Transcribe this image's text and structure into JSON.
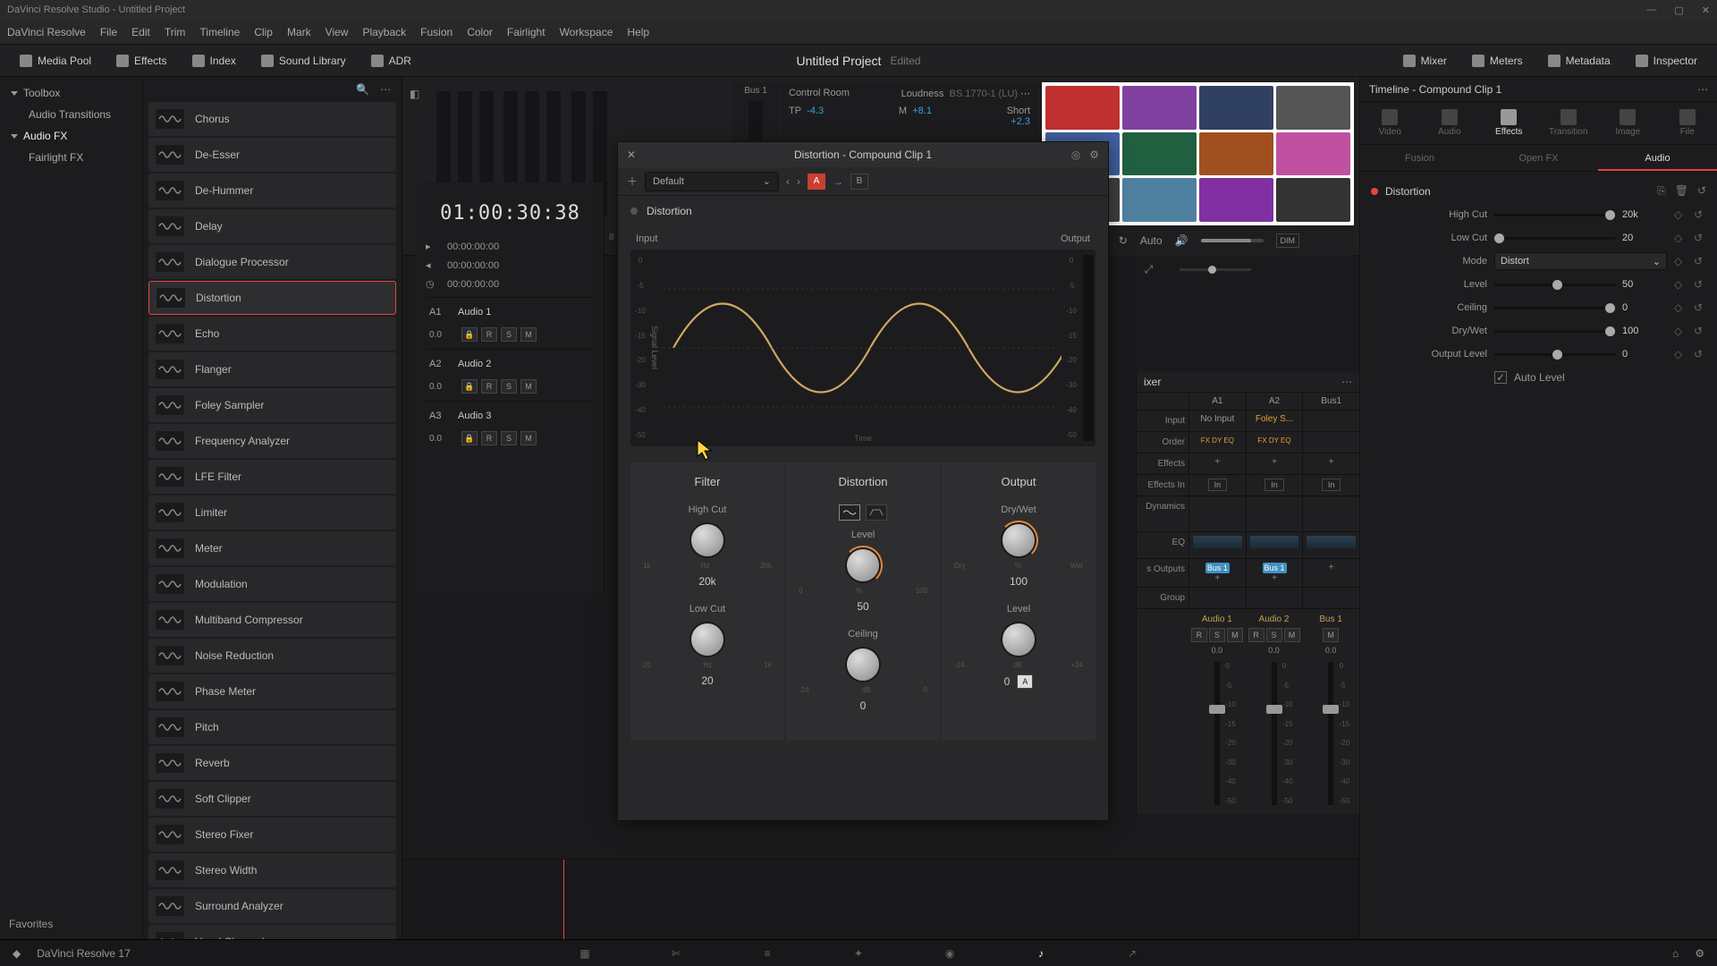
{
  "app": {
    "title": "DaVinci Resolve Studio - Untitled Project",
    "version": "DaVinci Resolve 17"
  },
  "menu": [
    "DaVinci Resolve",
    "File",
    "Edit",
    "Trim",
    "Timeline",
    "Clip",
    "Mark",
    "View",
    "Playback",
    "Fusion",
    "Color",
    "Fairlight",
    "Workspace",
    "Help"
  ],
  "toolbar": {
    "left": [
      {
        "label": "Media Pool"
      },
      {
        "label": "Effects"
      },
      {
        "label": "Index"
      },
      {
        "label": "Sound Library"
      },
      {
        "label": "ADR"
      }
    ],
    "right": [
      {
        "label": "Mixer"
      },
      {
        "label": "Meters"
      },
      {
        "label": "Metadata"
      },
      {
        "label": "Inspector"
      }
    ],
    "project": "Untitled Project",
    "edited": "Edited"
  },
  "tree": {
    "toolbox": "Toolbox",
    "audiotrans": "Audio Transitions",
    "audiofx": "Audio FX",
    "fairlight": "Fairlight FX",
    "favorites": "Favorites"
  },
  "fx": [
    "Chorus",
    "De-Esser",
    "De-Hummer",
    "Delay",
    "Dialogue Processor",
    "Distortion",
    "Echo",
    "Flanger",
    "Foley Sampler",
    "Frequency Analyzer",
    "LFE Filter",
    "Limiter",
    "Meter",
    "Modulation",
    "Multiband Compressor",
    "Noise Reduction",
    "Phase Meter",
    "Pitch",
    "Reverb",
    "Soft Clipper",
    "Stereo Fixer",
    "Stereo Width",
    "Surround Analyzer",
    "Vocal Channel"
  ],
  "fx_selected": "Distortion",
  "timecode": {
    "big": "01:00:30:38",
    "rows": [
      "00:00:00:00",
      "00:00:00:00",
      "00:00:00:00"
    ]
  },
  "tracks": [
    {
      "id": "A1",
      "name": "Audio 1",
      "vol": "0.0"
    },
    {
      "id": "A2",
      "name": "Audio 2",
      "vol": "0.0"
    },
    {
      "id": "A3",
      "name": "Audio 3",
      "vol": "0.0"
    }
  ],
  "control_room": {
    "title": "Control Room",
    "bus": "Bus 1",
    "loudness": "Loudness",
    "spec": "BS.1770-1 (LU)",
    "tp": "TP",
    "tpv": "-4.3",
    "m": "M",
    "mv": "+8.1",
    "short": "Short",
    "shortv": "+2.3"
  },
  "playback": {
    "auto": "Auto",
    "dim": "DIM"
  },
  "plugin": {
    "title": "Distortion - Compound Clip 1",
    "preset": "Default",
    "name": "Distortion",
    "input": "Input",
    "output": "Output",
    "time": "Time",
    "signal": "Signal Level",
    "sections": {
      "filter": "Filter",
      "distortion": "Distortion",
      "output": "Output"
    },
    "knobs": {
      "highcut": {
        "label": "High Cut",
        "scale_l": "1k",
        "scale_m": "Hz",
        "scale_r": "20k",
        "value": "20k"
      },
      "lowcut": {
        "label": "Low Cut",
        "scale_l": "20",
        "scale_m": "Hz",
        "scale_r": "1k",
        "value": "20"
      },
      "level": {
        "label": "Level",
        "scale_l": "0",
        "scale_m": "%",
        "scale_r": "100",
        "value": "50"
      },
      "ceiling": {
        "label": "Ceiling",
        "scale_l": "-24",
        "scale_m": "dB",
        "scale_r": "0",
        "value": "0"
      },
      "drywet": {
        "label": "Dry/Wet",
        "scale_l": "Dry",
        "scale_m": "%",
        "scale_r": "Wet",
        "value": "100"
      },
      "outlevel": {
        "label": "Level",
        "scale_l": "-24",
        "scale_m": "dB",
        "scale_r": "+24",
        "value": "0"
      }
    },
    "auto_btn": "A"
  },
  "mixer": {
    "title": "ixer",
    "cols": [
      "A1",
      "A2",
      "Bus1"
    ],
    "rows": {
      "input": "Input",
      "input_vals": [
        "No Input",
        "Foley S...",
        ""
      ],
      "order": "Order",
      "effects": "Effects",
      "effectsin": "Effects In",
      "dynamics": "Dynamics",
      "eq": "EQ",
      "outputs": "s Outputs",
      "group": "Group"
    },
    "bus_label": "Bus 1",
    "faders": [
      {
        "name": "Audio 1",
        "val": "0.0"
      },
      {
        "name": "Audio 2",
        "val": "0.0"
      },
      {
        "name": "Bus 1",
        "val": "0.0"
      }
    ],
    "fader_btns": [
      "R",
      "S",
      "M"
    ],
    "ticks": [
      "0",
      "-5",
      "-10",
      "-15",
      "-20",
      "-30",
      "-40",
      "-50"
    ]
  },
  "inspector": {
    "title": "Timeline - Compound Clip 1",
    "tabs": [
      "Video",
      "Audio",
      "Effects",
      "Transition",
      "Image",
      "File"
    ],
    "subtabs": [
      "Fusion",
      "Open FX",
      "Audio"
    ],
    "section": "Distortion",
    "params": {
      "highcut": {
        "label": "High Cut",
        "value": "20k"
      },
      "lowcut": {
        "label": "Low Cut",
        "value": "20"
      },
      "mode": {
        "label": "Mode",
        "value": "Distort"
      },
      "level": {
        "label": "Level",
        "value": "50"
      },
      "ceiling": {
        "label": "Ceiling",
        "value": "0"
      },
      "drywet": {
        "label": "Dry/Wet",
        "value": "100"
      },
      "output": {
        "label": "Output Level",
        "value": "0"
      },
      "auto": {
        "label": "Auto Level"
      }
    }
  },
  "meter_labels": [
    "0",
    "-5",
    "-10",
    "-15",
    "-20",
    "-30",
    "-40",
    "-50"
  ]
}
